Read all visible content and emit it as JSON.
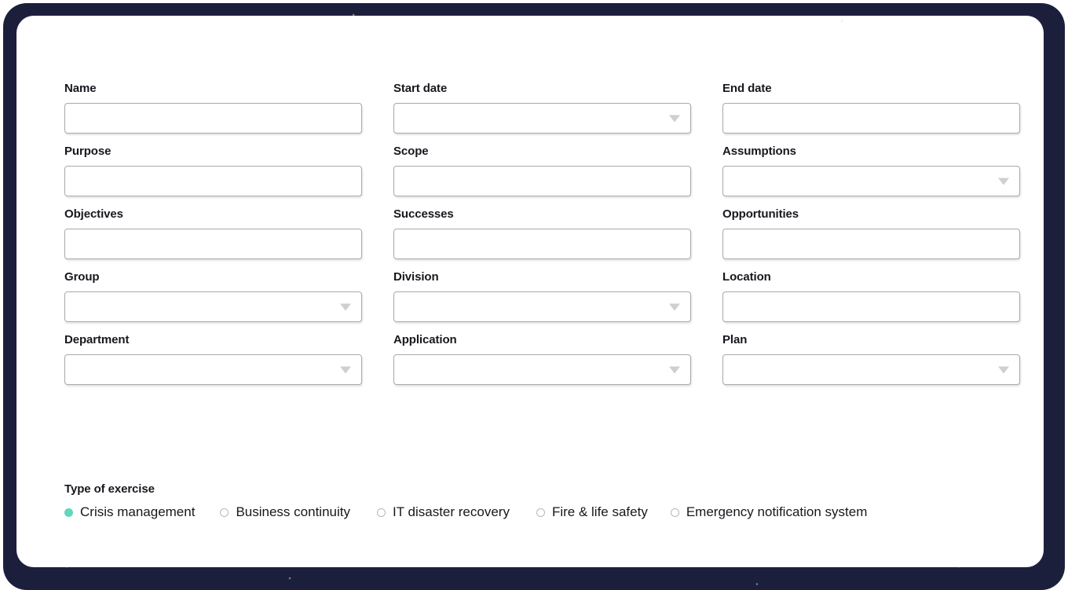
{
  "theme": {
    "frame_color": "#1c1f3c",
    "card_color": "#ffffff",
    "label_color": "#16181d",
    "field_border": "#a9a9a9",
    "caret_color": "#cfcfcf",
    "radio_selected_color": "#63d6be",
    "radio_empty_border": "#b8b8b8"
  },
  "form": {
    "rows": [
      [
        {
          "label": "Name",
          "type": "text",
          "value": "",
          "placeholder": "",
          "name": "name"
        },
        {
          "label": "Start date",
          "type": "select",
          "value": "",
          "placeholder": "",
          "name": "start-date"
        },
        {
          "label": "End date",
          "type": "text",
          "value": "",
          "placeholder": "",
          "name": "end-date"
        }
      ],
      [
        {
          "label": "Purpose",
          "type": "text",
          "value": "",
          "placeholder": "",
          "name": "purpose"
        },
        {
          "label": "Scope",
          "type": "text",
          "value": "",
          "placeholder": "",
          "name": "scope"
        },
        {
          "label": "Assumptions",
          "type": "select",
          "value": "",
          "placeholder": "",
          "name": "assumptions"
        }
      ],
      [
        {
          "label": "Objectives",
          "type": "text",
          "value": "",
          "placeholder": "",
          "name": "objectives"
        },
        {
          "label": "Successes",
          "type": "text",
          "value": "",
          "placeholder": "",
          "name": "successes"
        },
        {
          "label": "Opportunities",
          "type": "text",
          "value": "",
          "placeholder": "",
          "name": "opportunities"
        }
      ],
      [
        {
          "label": "Group",
          "type": "select",
          "value": "",
          "placeholder": "",
          "name": "group"
        },
        {
          "label": "Division",
          "type": "select",
          "value": "",
          "placeholder": "",
          "name": "division"
        },
        {
          "label": "Location",
          "type": "text",
          "value": "",
          "placeholder": "",
          "name": "location"
        }
      ],
      [
        {
          "label": "Department",
          "type": "select",
          "value": "",
          "placeholder": "",
          "name": "department"
        },
        {
          "label": "Application",
          "type": "select",
          "value": "",
          "placeholder": "",
          "name": "application"
        },
        {
          "label": "Plan",
          "type": "select",
          "value": "",
          "placeholder": "",
          "name": "plan"
        }
      ]
    ]
  },
  "type_of_exercise": {
    "legend": "Type of exercise",
    "options": [
      {
        "label": "Crisis management",
        "selected": true,
        "name": "crisis-management"
      },
      {
        "label": "Business continuity",
        "selected": false,
        "name": "business-continuity"
      },
      {
        "label": "IT disaster recovery",
        "selected": false,
        "name": "it-disaster-recovery"
      },
      {
        "label": "Fire & life safety",
        "selected": false,
        "name": "fire-life-safety"
      },
      {
        "label": "Emergency notification system",
        "selected": false,
        "name": "emergency-notification-system"
      }
    ]
  }
}
